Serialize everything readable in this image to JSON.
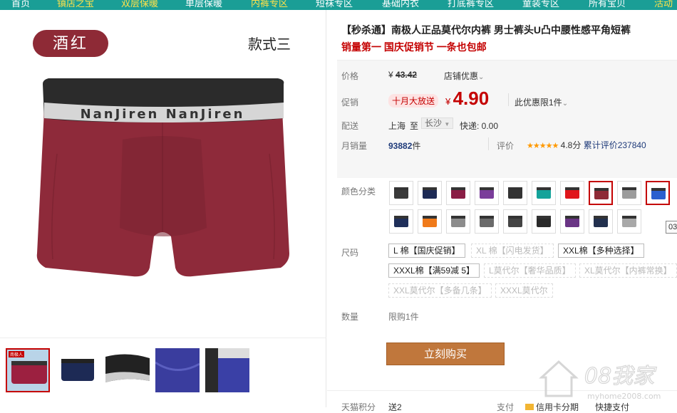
{
  "nav": {
    "items": [
      {
        "label": "首页",
        "highlight": false
      },
      {
        "label": "镇店之宝",
        "highlight": true
      },
      {
        "label": "双层保暖",
        "highlight": true
      },
      {
        "label": "单层保暖",
        "highlight": false
      },
      {
        "label": "内裤专区",
        "highlight": true
      },
      {
        "label": "短袜专区",
        "highlight": false
      },
      {
        "label": "基础内衣",
        "highlight": false
      },
      {
        "label": "打底裤专区",
        "highlight": false
      },
      {
        "label": "童装专区",
        "highlight": false
      },
      {
        "label": "所有宝贝",
        "highlight": false
      },
      {
        "label": "活动",
        "highlight": true
      }
    ]
  },
  "gallery": {
    "color_badge": "酒红",
    "style_label": "款式三",
    "brand_band": "NanJiren NanJiren",
    "thumb_brand": "南极人"
  },
  "product": {
    "title": "【秒杀通】南极人正品莫代尔内裤 男士裤头U凸中腰性感平角短裤",
    "subtitle": "销量第一 国庆促销节 一条也包邮"
  },
  "price": {
    "label": "价格",
    "currency": "¥",
    "original": "43.42",
    "store_discount": "店铺优惠",
    "promo_label": "促销",
    "promo_tag": "十月大放送",
    "current": "4.90",
    "limit_note": "此优惠限1件"
  },
  "delivery": {
    "label": "配送",
    "from": "上海",
    "to_word": "至",
    "to_city": "长沙",
    "express": "快递: 0.00"
  },
  "sales": {
    "label": "月销量",
    "count": "93882",
    "unit": "件",
    "rating_label": "评价",
    "stars": "★★★★★",
    "score": "4.8分",
    "reviews": "累计评价237840"
  },
  "colors": {
    "label": "颜色分类",
    "tooltip": "03",
    "swatches": [
      {
        "color": "#3a3a3a",
        "selected": false
      },
      {
        "color": "#1d2a55",
        "selected": false
      },
      {
        "color": "#8a1d45",
        "selected": false
      },
      {
        "color": "#7a3d9a",
        "selected": false
      },
      {
        "color": "#333333",
        "selected": false
      },
      {
        "color": "#14a39a",
        "selected": false
      },
      {
        "color": "#e0161b",
        "selected": false
      },
      {
        "color": "#8e2a36",
        "selected": true
      },
      {
        "color": "#9c9c9c",
        "selected": false
      },
      {
        "color": "#2a5fcf",
        "selected": true
      },
      {
        "color": "#1f2f5a",
        "selected": false
      },
      {
        "color": "#f07a1a",
        "selected": false
      },
      {
        "color": "#8c8c8c",
        "selected": false
      },
      {
        "color": "#6a6a6a",
        "selected": false
      },
      {
        "color": "#444444",
        "selected": false
      },
      {
        "color": "#2a2a2a",
        "selected": false
      },
      {
        "color": "#6a3585",
        "selected": false
      },
      {
        "color": "#22304e",
        "selected": false
      },
      {
        "color": "#a8a8a8",
        "selected": false
      }
    ]
  },
  "sizes": {
    "label": "尺码",
    "options": [
      {
        "label": "L 棉【国庆促销】",
        "disabled": false
      },
      {
        "label": "XL 棉【闪电发货】",
        "disabled": true
      },
      {
        "label": "XXL棉【多种选择】",
        "disabled": false
      },
      {
        "label": "XXXL棉【满59减 5】",
        "disabled": false
      },
      {
        "label": "L莫代尔【奢华品质】",
        "disabled": true
      },
      {
        "label": "XL莫代尔【内裤常换】",
        "disabled": true
      },
      {
        "label": "XXL莫代尔【多备几条】",
        "disabled": true
      },
      {
        "label": "XXXL莫代尔",
        "disabled": true
      }
    ]
  },
  "quantity": {
    "label": "数量",
    "limit": "限购1件"
  },
  "buy_button": "立刻购买",
  "bottom": {
    "points_label": "天猫积分",
    "points_value": "送2",
    "pay_label": "支付",
    "credit": "信用卡分期",
    "quick_pay": "快捷支付"
  },
  "watermark": {
    "title": "08我家",
    "url": "myhome2008.com"
  }
}
